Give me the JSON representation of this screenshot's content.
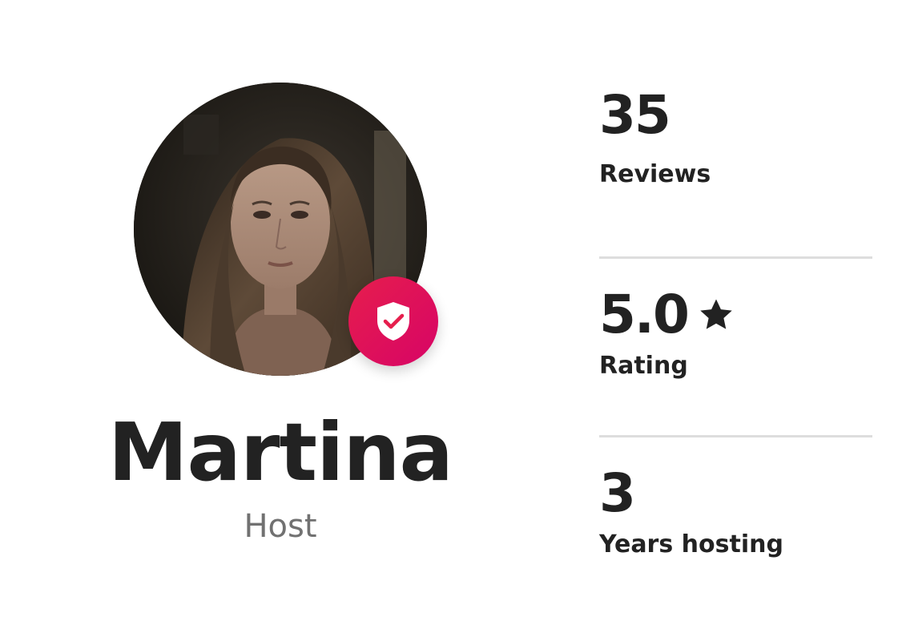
{
  "host": {
    "name": "Martina",
    "role": "Host",
    "avatar_icon": "host-profile-photo",
    "verified_badge_icon": "shield-check-icon",
    "badge_color": "#e61e4d"
  },
  "stats": [
    {
      "value": "35",
      "label": "Reviews"
    },
    {
      "value": "5.0",
      "label": "Rating",
      "icon": "star-icon"
    },
    {
      "value": "3",
      "label": "Years hosting"
    }
  ],
  "colors": {
    "text_primary": "#222222",
    "text_secondary": "#717171",
    "divider": "#dddddd",
    "accent": "#e61e4d"
  }
}
